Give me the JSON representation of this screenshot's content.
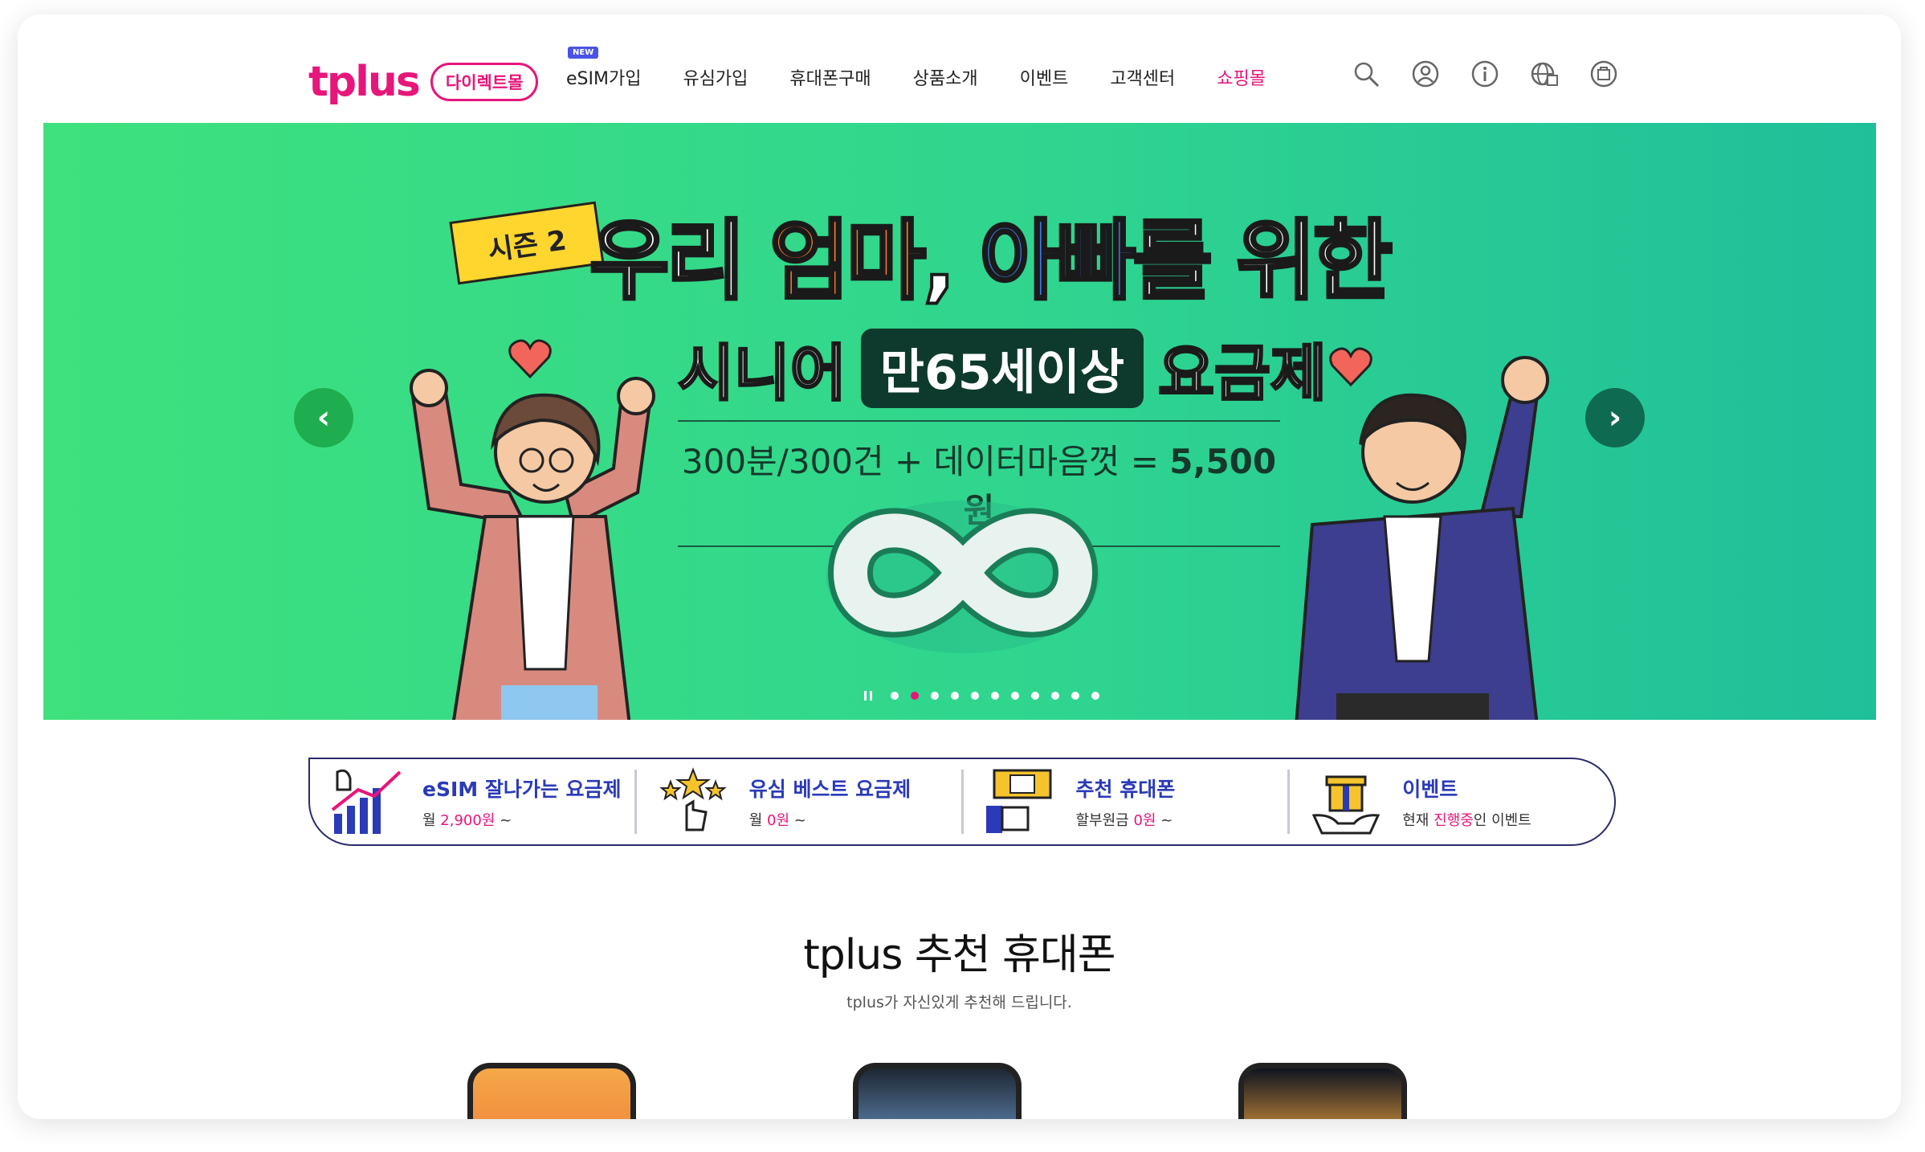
{
  "header": {
    "logo_text": "tplus",
    "logo_badge": "다이렉트몰",
    "nav_new_badge": "NEW",
    "nav": [
      "eSIM가입",
      "유심가입",
      "휴대폰구매",
      "상품소개",
      "이벤트",
      "고객센터",
      "쇼핑몰"
    ],
    "icons": [
      "search-icon",
      "user-icon",
      "info-icon",
      "globe-icon",
      "cart-icon"
    ]
  },
  "banner": {
    "season": "시즌 2",
    "headline_pre": "우리 ",
    "headline_mom": "엄마",
    "headline_comma": ", ",
    "headline_dad": "아빠",
    "headline_post": "를 위한",
    "senior": "시니어",
    "age": "만65세이상",
    "plan": "요금제",
    "price_text": "300분/300건 + 데이터마음껏 = ",
    "price_value": "5,500원",
    "slide_count": 11,
    "active_slide": 2,
    "colors": {
      "accent": "#e6167a",
      "banner_start": "#3ee17d",
      "banner_end": "#1fbf9a"
    }
  },
  "quick_menu": [
    {
      "title": "eSIM 잘나가는 요금제",
      "sub_pre": "월 ",
      "sub_hi": "2,900원",
      "sub_post": " ~",
      "icon": "chart-icon"
    },
    {
      "title": "유심 베스트 요금제",
      "sub_pre": "월 ",
      "sub_hi": "0원",
      "sub_post": " ~",
      "icon": "stars-icon"
    },
    {
      "title": "추천 휴대폰",
      "sub_pre": "할부원금 ",
      "sub_hi": "0원",
      "sub_post": " ~",
      "icon": "recommend-sign-icon"
    },
    {
      "title": "이벤트",
      "sub_pre": "현재 ",
      "sub_hi": "진행중",
      "sub_post": "인 이벤트",
      "icon": "gift-icon"
    }
  ],
  "section": {
    "title": "tplus 추천 휴대폰",
    "subtitle": "tplus가 자신있게 추천해 드립니다."
  }
}
